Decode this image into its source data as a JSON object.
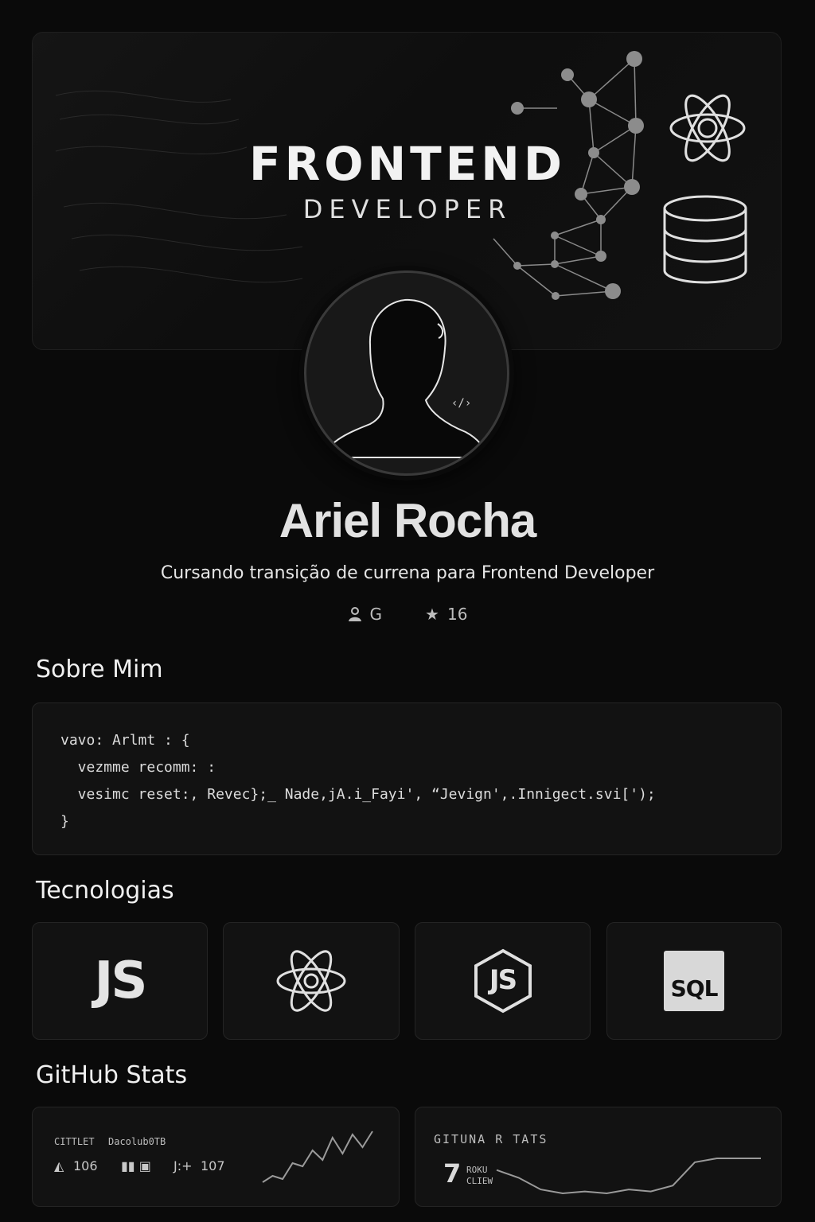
{
  "banner": {
    "title": "FRONTEND",
    "subtitle": "DEVELOPER",
    "icons": [
      "network-graph-icon",
      "react-icon",
      "database-icon"
    ]
  },
  "profile": {
    "name": "Ariel Rocha",
    "tagline": "Cursando transição de currena para Frontend Developer",
    "followers_value": "G",
    "stars_value": "16"
  },
  "about": {
    "title": "Sobre Mim",
    "code_lines": [
      "vavo: Arlmt : {",
      "  vezmme recomm: :",
      "  vesimc reset:, Revec};_ Nade,jA.i_Fayi', “Jevign',.Innigect.svi[');",
      "}"
    ]
  },
  "technologies": {
    "title": "Tecnologias",
    "items": [
      {
        "label": "JS",
        "icon": "javascript-icon"
      },
      {
        "label": "",
        "icon": "react-icon"
      },
      {
        "label": "JS",
        "icon": "nodejs-icon"
      },
      {
        "label": "SQL",
        "icon": "sql-icon"
      }
    ]
  },
  "github": {
    "title": "GitHub Stats",
    "card1": {
      "label_a": "CITTLET",
      "label_b": "Dacolub0TB",
      "stat1": "106",
      "stat2": "107",
      "stat2_prefix": "J:+",
      "trend": [
        3,
        5,
        4,
        9,
        8,
        13,
        10,
        17,
        12,
        18,
        14,
        19
      ]
    },
    "card2": {
      "title": "GITUNA R TATS",
      "big_value": "7",
      "sub_a": "ROKU",
      "sub_b": "CLIEW",
      "trend": [
        12,
        10,
        7,
        6,
        6.5,
        6,
        7,
        6.5,
        8,
        14,
        15,
        15,
        15
      ]
    }
  }
}
